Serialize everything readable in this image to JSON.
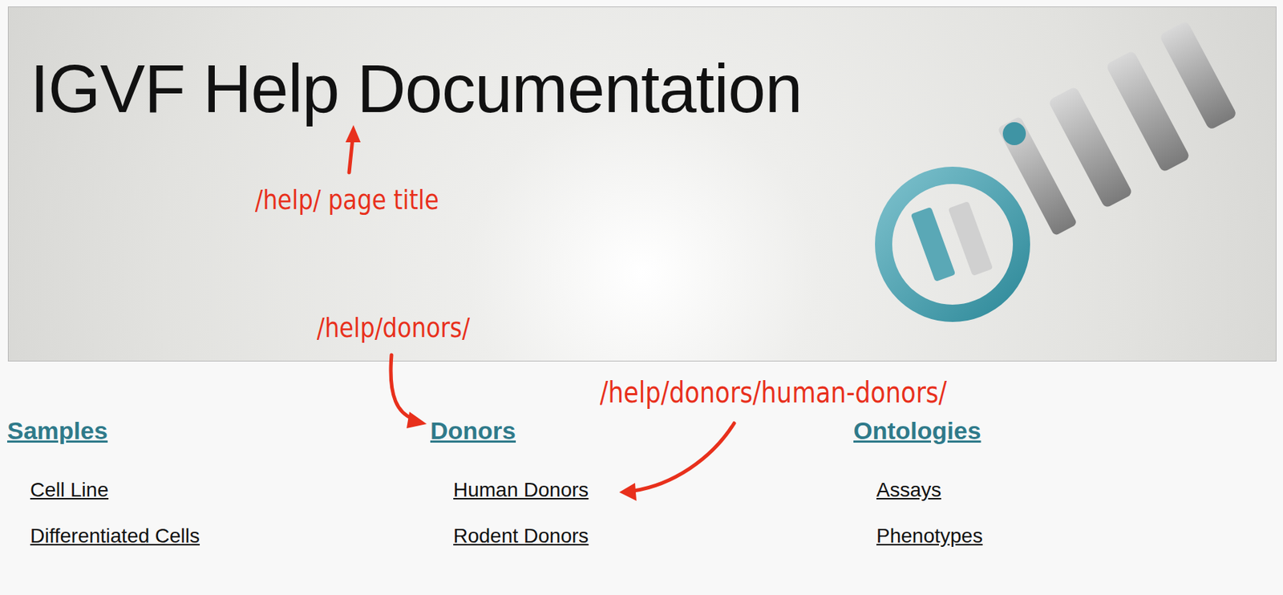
{
  "page": {
    "title": "IGVF Help Documentation"
  },
  "sections": [
    {
      "title": "Samples",
      "links": [
        "Cell Line",
        "Differentiated Cells"
      ]
    },
    {
      "title": "Donors",
      "links": [
        "Human Donors",
        "Rodent Donors"
      ]
    },
    {
      "title": "Ontologies",
      "links": [
        "Assays",
        "Phenotypes"
      ]
    }
  ],
  "annotations": [
    {
      "text": "/help/ page title"
    },
    {
      "text": "/help/donors/"
    },
    {
      "text": "/help/donors/human-donors/"
    }
  ]
}
